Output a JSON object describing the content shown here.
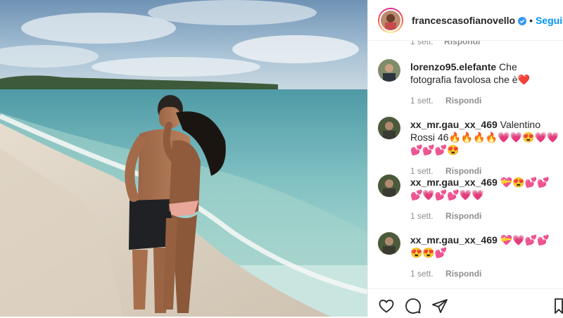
{
  "post": {
    "author": "francescasofianovello",
    "follow_label": "Segui",
    "dot": "•"
  },
  "ghost_row": {
    "time": "1 sett.",
    "reply": "Rispondi"
  },
  "comments": [
    {
      "user": "lorenzo95.elefante",
      "text": "Che fotografia favolosa che è❤️",
      "time": "1 sett.",
      "reply": "Rispondi"
    },
    {
      "user": "xx_mr.gau_xx_469",
      "text": "Valentino Rossi 46🔥🔥🔥🔥💗💗😍💗💗💕💕💕😍",
      "time": "1 sett.",
      "reply": "Rispondi"
    },
    {
      "user": "xx_mr.gau_xx_469",
      "text": "💝😍💕💕💕💗💕💕💗💗",
      "time": "1 sett.",
      "reply": "Rispondi"
    },
    {
      "user": "xx_mr.gau_xx_469",
      "text": "💝💗💕💕😍😍💕",
      "time": "1 sett.",
      "reply": "Rispondi"
    }
  ],
  "icons": {
    "like": "heart-icon",
    "comment": "comment-icon",
    "share": "share-icon",
    "save": "bookmark-icon",
    "verified": "verified-badge-icon"
  },
  "colors": {
    "follow_blue": "#0095f6",
    "muted_text": "#8e8e8e",
    "border": "#efefef"
  }
}
